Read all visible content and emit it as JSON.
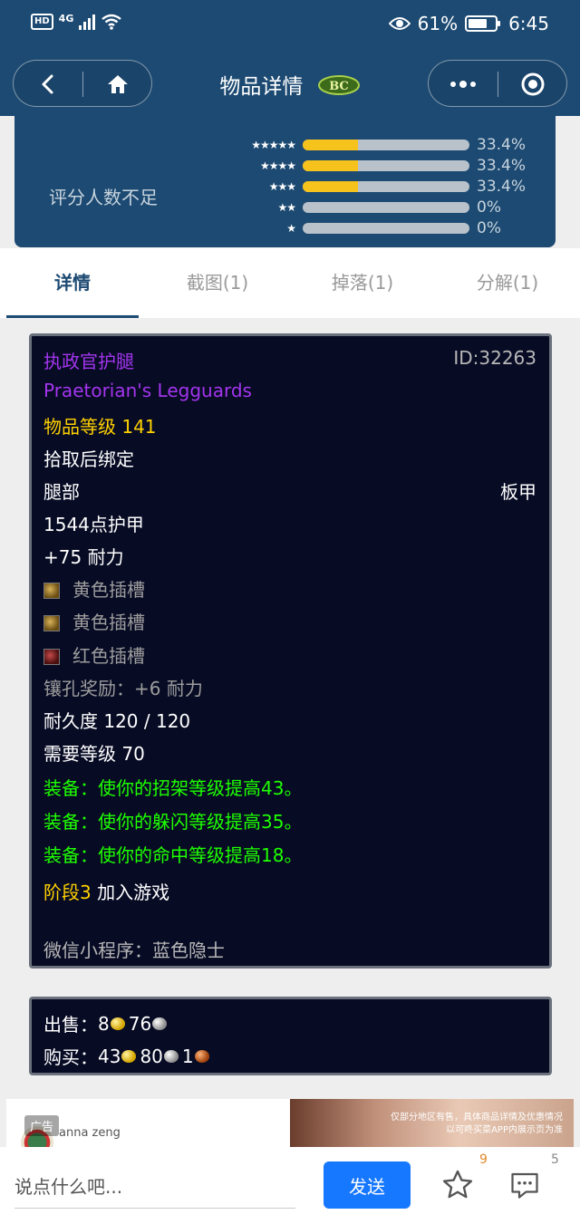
{
  "status_bar": {
    "network": "4G",
    "battery": "61%",
    "time": "6:45",
    "hd": "HD"
  },
  "nav": {
    "title": "物品详情",
    "badge": "BC"
  },
  "rating": {
    "note": "评分人数不足",
    "rows": [
      {
        "stars": "★★★★★",
        "pct": "33.4%",
        "fill": 0.334
      },
      {
        "stars": "★★★★",
        "pct": "33.4%",
        "fill": 0.334
      },
      {
        "stars": "★★★",
        "pct": "33.4%",
        "fill": 0.334
      },
      {
        "stars": "★★",
        "pct": "0%",
        "fill": 0
      },
      {
        "stars": "★",
        "pct": "0%",
        "fill": 0
      }
    ]
  },
  "tabs": [
    {
      "label": "详情",
      "active": true
    },
    {
      "label": "截图(1)"
    },
    {
      "label": "掉落(1)"
    },
    {
      "label": "分解(1)"
    }
  ],
  "item": {
    "name_cn": "执政官护腿",
    "id": "ID:32263",
    "name_en": "Praetorian's Legguards",
    "item_level": "物品等级 141",
    "bind": "拾取后绑定",
    "slot": "腿部",
    "armor_type": "板甲",
    "armor": "1544点护甲",
    "stamina": "+75 耐力",
    "sockets": [
      {
        "label": "黄色插槽",
        "color": "yellow"
      },
      {
        "label": "黄色插槽",
        "color": "yellow"
      },
      {
        "label": "红色插槽",
        "color": "red"
      }
    ],
    "socket_bonus": "镶孔奖励：+6 耐力",
    "durability": "耐久度 120 / 120",
    "required_level": "需要等级 70",
    "equip_effects": [
      "装备：使你的招架等级提高43。",
      "装备：使你的躲闪等级提高35。",
      "装备：使你的命中等级提高18。"
    ],
    "phase_label": "阶段3",
    "phase_text": " 加入游戏",
    "footer": "微信小程序：蓝色隐士"
  },
  "price": {
    "sell_label": "出售：",
    "sell_gold": "8",
    "sell_silver": "76",
    "buy_label": "购买：",
    "buy_gold": "43",
    "buy_silver": "80",
    "buy_copper": "1"
  },
  "ad": {
    "label": "广告",
    "user": "anna zeng",
    "caption_line1": "仅部分地区有售，具体商品详情及优惠情况",
    "caption_line2": "以可咚买菜APP内展示页为准"
  },
  "bottom": {
    "placeholder": "说点什么吧...",
    "send": "发送",
    "favorites_count": "9",
    "comments_count": "5"
  }
}
